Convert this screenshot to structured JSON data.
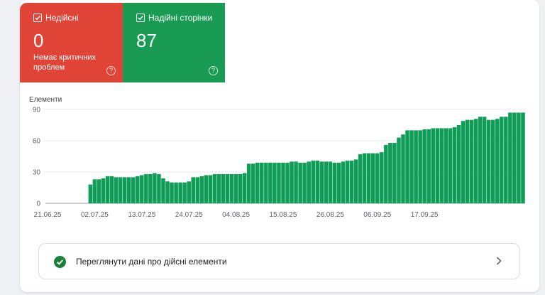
{
  "status_tiles": {
    "invalid": {
      "label": "Недійсні",
      "count": "0",
      "subtext": "Немає критичних проблем",
      "color": "#df4437",
      "icon": "checkbox-checked-icon",
      "help_icon": "help-icon"
    },
    "valid": {
      "label": "Надійні сторінки",
      "count": "87",
      "color": "#1a9b53",
      "icon": "checkbox-checked-icon",
      "help_icon": "help-icon"
    }
  },
  "chart_data": {
    "type": "bar",
    "title": "",
    "ylabel": "Елементи",
    "xlabel": "",
    "ylim": [
      0,
      90
    ],
    "yticks": [
      "0",
      "30",
      "60",
      "90"
    ],
    "xtick_labels": [
      "21.06.25",
      "02.07.25",
      "13.07.25",
      "24.07.25",
      "04.08.25",
      "15.08.25",
      "26.08.25",
      "06.09.25",
      "17.09.25"
    ],
    "start_date": "21.06.25",
    "bar_color": "#0f9d58",
    "grid": true,
    "series": [
      {
        "values": [
          0,
          0,
          0,
          0,
          0,
          0,
          0,
          0,
          0,
          0,
          18,
          23,
          23,
          24,
          26,
          26,
          25,
          25,
          25,
          25,
          25,
          26,
          27,
          28,
          28,
          29,
          28,
          24,
          21,
          20,
          20,
          20,
          20,
          21,
          25,
          25,
          26,
          27,
          27,
          28,
          28,
          28,
          28,
          28,
          28,
          28,
          29,
          38,
          38,
          39,
          39,
          39,
          39,
          39,
          39,
          39,
          39,
          40,
          40,
          39,
          39,
          40,
          41,
          41,
          40,
          40,
          40,
          39,
          39,
          40,
          41,
          41,
          42,
          47,
          48,
          48,
          48,
          48,
          49,
          56,
          58,
          58,
          63,
          66,
          70,
          70,
          70,
          70,
          71,
          71,
          72,
          72,
          72,
          72,
          72,
          73,
          75,
          79,
          80,
          80,
          81,
          83,
          83,
          80,
          80,
          81,
          83,
          83,
          87,
          87,
          87,
          87
        ]
      }
    ]
  },
  "action_row": {
    "text": "Переглянути дані про дійсні елементи",
    "status_icon": "check-circle-icon",
    "chevron_icon": "chevron-right-icon"
  }
}
